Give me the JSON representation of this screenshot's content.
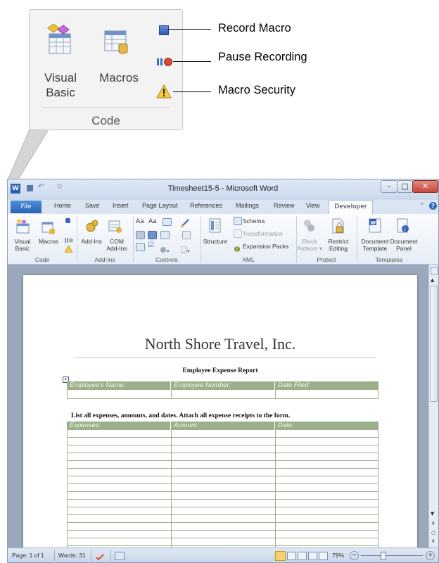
{
  "callout": {
    "visual_basic_line1": "Visual",
    "visual_basic_line2": "Basic",
    "macros_label": "Macros",
    "group_label": "Code",
    "record_macro": "Record Macro",
    "pause_recording": "Pause Recording",
    "macro_security": "Macro Security"
  },
  "window": {
    "title": "Timesheet15-5 - Microsoft Word",
    "tabs": [
      "File",
      "Home",
      "Save",
      "Insert",
      "Page Layout",
      "References",
      "Mailings",
      "Review",
      "View",
      "Developer"
    ]
  },
  "ribbon": {
    "visual_basic": "Visual Basic",
    "visual_basic_l1": "Visual",
    "visual_basic_l2": "Basic",
    "macros": "Macros",
    "addins": "Add-Ins",
    "com_l1": "COM",
    "com_l2": "Add-Ins",
    "structure": "Structure",
    "schema": "Schema",
    "transformation": "Transformation",
    "expansion_packs": "Expansion Packs",
    "block_l1": "Block",
    "block_l2": "Authors",
    "restrict_l1": "Restrict",
    "restrict_l2": "Editing",
    "doc_template_l1": "Document",
    "doc_template_l2": "Template",
    "doc_panel_l1": "Document",
    "doc_panel_l2": "Panel",
    "groups": {
      "code": "Code",
      "addins": "Add-Ins",
      "controls": "Controls",
      "xml": "XML",
      "protect": "Protect",
      "templates": "Templates"
    }
  },
  "document": {
    "company": "North Shore Travel, Inc.",
    "report_title": "Employee Expense Report",
    "info_headers": [
      "Employee's Name:",
      "Employee Number:",
      "Date Filed:"
    ],
    "instructions": "List all expenses, amounts, and dates. Attach all expense receipts to the form.",
    "expense_headers": [
      "Expenses:",
      "Amount:",
      "Date:"
    ]
  },
  "status": {
    "page": "Page: 1 of 1",
    "words": "Words: 31",
    "zoom": "79%"
  },
  "colors": {
    "table_header": "#9bb08a",
    "file_tab": "#2a62b1",
    "close_button": "#c9473a"
  }
}
